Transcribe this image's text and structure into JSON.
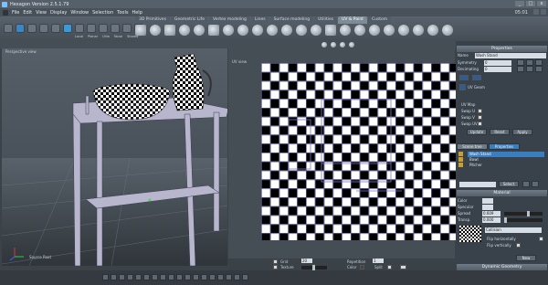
{
  "title": "Hexagon Version 2.5.1.79",
  "menu": [
    "File",
    "Edit",
    "View",
    "Display",
    "Window",
    "Selection",
    "Tools",
    "Help"
  ],
  "clock": "05:01",
  "tabs": [
    {
      "label": "3D Primitives",
      "active": false
    },
    {
      "label": "Geometric Life",
      "active": false
    },
    {
      "label": "Vertex modeling",
      "active": false
    },
    {
      "label": "Lines",
      "active": false
    },
    {
      "label": "Surface modeling",
      "active": false
    },
    {
      "label": "Utilities",
      "active": false
    },
    {
      "label": "UV & Paint",
      "active": true
    },
    {
      "label": "Custom",
      "active": false
    }
  ],
  "tool_labels": [
    "Local",
    "Planar",
    "UVw",
    "None",
    "Shared"
  ],
  "viewport_3d": {
    "label": "Perspective view",
    "axis_label": "Source Root"
  },
  "uv_view": {
    "label": "UV view"
  },
  "uv_controls": {
    "grid": "Grid",
    "texture": "Texture",
    "grid_val": "20",
    "repetition": "Repetition",
    "rep_val": "1",
    "color": "Color",
    "split": "Split"
  },
  "properties": {
    "header": "Properties",
    "name_label": "Name",
    "name_value": "Wash Stand",
    "symmetry_label": "Symmetry",
    "symmetry_value": "0",
    "decimating_label": "Decimating",
    "decimating_value": "0",
    "faces_label": "UV Geom",
    "uvmap_label": "UV Map",
    "swap_u": "Swap U",
    "swap_v": "Swap V",
    "swap_uv": "Swap UV",
    "btn_update": "Update",
    "btn_reset": "Reset",
    "btn_apply": "Apply"
  },
  "scene_tabs": {
    "scene_tree": "Scene tree",
    "properties": "Properties"
  },
  "scene_items": [
    {
      "label": "Wash Stand",
      "selected": true
    },
    {
      "label": "Bowl",
      "selected": false
    },
    {
      "label": "Pitcher",
      "selected": false
    }
  ],
  "select_label": "Select",
  "material": {
    "header": "Material",
    "color": "Color",
    "specular": "Specular",
    "spread": "Spread",
    "spread_val": "0.609",
    "transp": "Transp.",
    "transp_val": "0.000",
    "uv_texture": "UV Texture",
    "collision": "Collision",
    "flip_h": "Flip horizontally",
    "flip_v": "Flip vertically",
    "new": "New"
  },
  "dynamic_geometry": "Dynamic Geometry",
  "colors": {
    "accent": "#3b7ec0",
    "panel": "#39414a",
    "viewport": "#4a535b"
  }
}
